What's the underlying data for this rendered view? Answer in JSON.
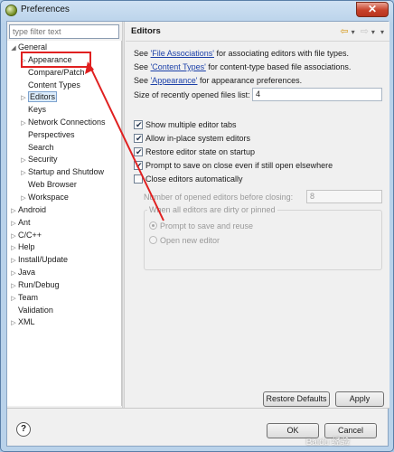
{
  "window": {
    "title": "Preferences",
    "close_glyph": "✕",
    "app_icon": "eclipse-icon"
  },
  "filter": {
    "placeholder": "type filter text"
  },
  "tree": {
    "general": "General",
    "appearance": "Appearance",
    "compare_patch": "Compare/Patch",
    "content_types": "Content Types",
    "editors": "Editors",
    "keys": "Keys",
    "network": "Network Connections",
    "perspectives": "Perspectives",
    "search": "Search",
    "security": "Security",
    "startup": "Startup and Shutdow",
    "web_browser": "Web Browser",
    "workspace": "Workspace",
    "android": "Android",
    "ant": "Ant",
    "ccpp": "C/C++",
    "help": "Help",
    "install_update": "Install/Update",
    "java": "Java",
    "run_debug": "Run/Debug",
    "team": "Team",
    "validation": "Validation",
    "xml": "XML"
  },
  "pane": {
    "title": "Editors",
    "see1_pre": "See ",
    "see1_link": "'File Associations'",
    "see1_post": " for associating editors with file types.",
    "see2_pre": "See ",
    "see2_link": "'Content Types'",
    "see2_post": " for content-type based file associations.",
    "see3_pre": "See ",
    "see3_link": "'Appearance'",
    "see3_post": " for appearance preferences.",
    "recent_label": "Size of recently opened files list:",
    "recent_value": "4",
    "cb_show_tabs": "Show multiple editor tabs",
    "cb_inplace": "Allow in-place system editors",
    "cb_restore": "Restore editor state on startup",
    "cb_prompt": "Prompt to save on close even if still open elsewhere",
    "cb_close_auto": "Close editors automatically",
    "num_opened_label": "Number of opened editors before closing:",
    "num_opened_value": "8",
    "dirty_group": "When all editors are dirty or pinned",
    "radio_prompt": "Prompt to save and reuse",
    "radio_open_new": "Open new editor",
    "restore_defaults": "Restore Defaults",
    "apply": "Apply"
  },
  "footer": {
    "help": "?",
    "ok": "OK",
    "cancel": "Cancel"
  },
  "watermark": "Baidu 经验",
  "colors": {
    "annotation": "#e02020",
    "link": "#1a3fa8"
  }
}
